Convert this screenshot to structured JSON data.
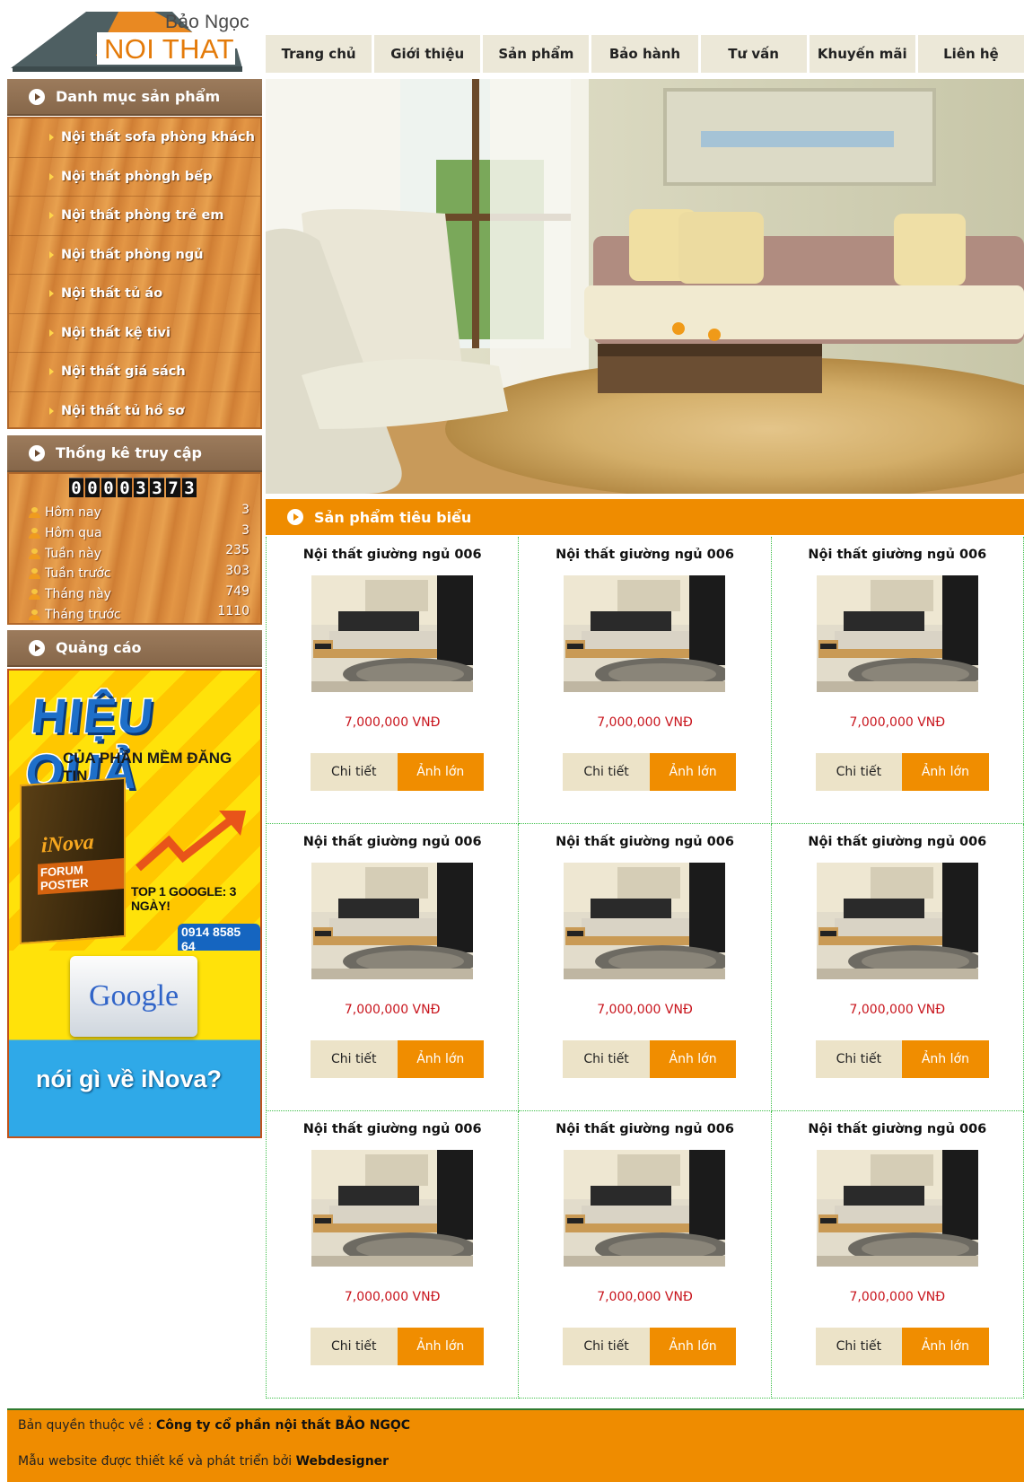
{
  "logo": {
    "brand": "Bảo Ngọc",
    "main": "NOI THAT"
  },
  "nav": [
    "Trang chủ",
    "Giới thiệu",
    "Sản phẩm",
    "Bảo hành",
    "Tư vấn",
    "Khuyến mãi",
    "Liên hệ"
  ],
  "sidebar": {
    "categories_title": "Danh mục sản phẩm",
    "categories": [
      "Nội thất sofa phòng khách",
      "Nội thất phòngh bếp",
      "Nội thất phòng trẻ em",
      "Nội thất phòng ngủ",
      "Nội thất tủ áo",
      "Nội thất kệ tivi",
      "Nội thất giá sách",
      "Nội thất tủ hồ sơ"
    ],
    "stats_title": "Thống kê truy cập",
    "counter": "00003373",
    "stats": [
      {
        "label": "Hôm nay",
        "value": "3"
      },
      {
        "label": "Hôm qua",
        "value": "3"
      },
      {
        "label": "Tuần này",
        "value": "235"
      },
      {
        "label": "Tuần trước",
        "value": "303"
      },
      {
        "label": "Tháng này",
        "value": "749"
      },
      {
        "label": "Tháng trước",
        "value": "1110"
      }
    ],
    "ads_title": "Quảng cáo",
    "ad1": {
      "headline": "HIỆU QUẢ",
      "subline": "CỦA PHẦN MỀM ĐĂNG TIN",
      "box_brand": "iNova",
      "box_name": "FORUM POSTER",
      "tagline": "TOP 1 GOOGLE: 3 NGÀY!",
      "phone": "0914 8585 64"
    },
    "ad2": {
      "card": "Google",
      "text": "nói gì về iNova?"
    }
  },
  "featured": {
    "title": "Sản phẩm tiêu biểu",
    "products": [
      {
        "name": "Nội thất giường ngủ 006",
        "price": "7,000,000 VNĐ",
        "detail": "Chi tiết",
        "large": "Ảnh lớn"
      },
      {
        "name": "Nội thất giường ngủ 006",
        "price": "7,000,000 VNĐ",
        "detail": "Chi tiết",
        "large": "Ảnh lớn"
      },
      {
        "name": "Nội thất giường ngủ 006",
        "price": "7,000,000 VNĐ",
        "detail": "Chi tiết",
        "large": "Ảnh lớn"
      },
      {
        "name": "Nội thất giường ngủ 006",
        "price": "7,000,000 VNĐ",
        "detail": "Chi tiết",
        "large": "Ảnh lớn"
      },
      {
        "name": "Nội thất giường ngủ 006",
        "price": "7,000,000 VNĐ",
        "detail": "Chi tiết",
        "large": "Ảnh lớn"
      },
      {
        "name": "Nội thất giường ngủ 006",
        "price": "7,000,000 VNĐ",
        "detail": "Chi tiết",
        "large": "Ảnh lớn"
      },
      {
        "name": "Nội thất giường ngủ 006",
        "price": "7,000,000 VNĐ",
        "detail": "Chi tiết",
        "large": "Ảnh lớn"
      },
      {
        "name": "Nội thất giường ngủ 006",
        "price": "7,000,000 VNĐ",
        "detail": "Chi tiết",
        "large": "Ảnh lớn"
      },
      {
        "name": "Nội thất giường ngủ 006",
        "price": "7,000,000 VNĐ",
        "detail": "Chi tiết",
        "large": "Ảnh lớn"
      }
    ]
  },
  "footer": {
    "copyright_prefix": "Bản quyền thuộc về :",
    "company": "Công ty cổ phần nội thất BẢO NGỌC",
    "design_prefix": "Mẫu website được thiết kế và phát triển bởi",
    "designer": "Webdesigner"
  },
  "colors": {
    "accent": "#ef8c00",
    "price": "#c8141c",
    "header_brown": "#8b6b4e",
    "grid_line": "#3fbf4a"
  }
}
